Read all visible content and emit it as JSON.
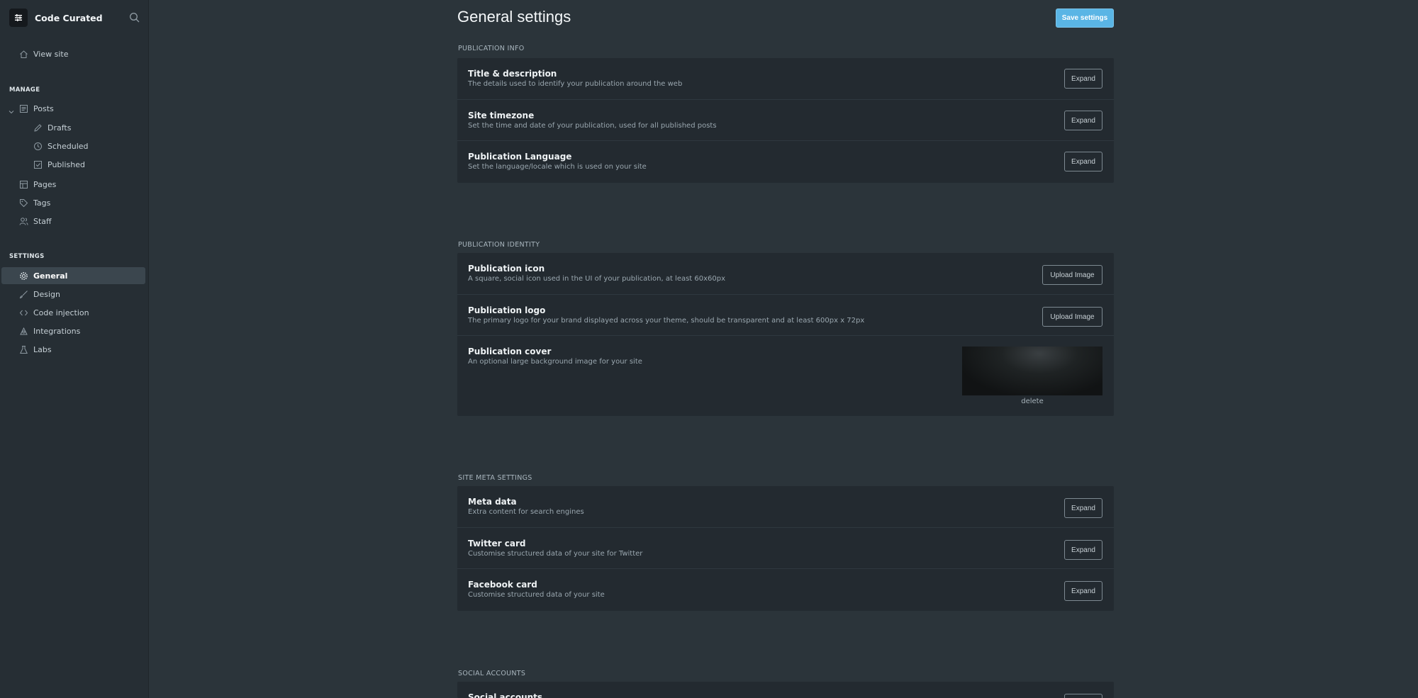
{
  "brand": {
    "name": "Code Curated"
  },
  "sidebar": {
    "view_site": "View site",
    "manage_label": "MANAGE",
    "posts": "Posts",
    "drafts": "Drafts",
    "scheduled": "Scheduled",
    "published": "Published",
    "pages": "Pages",
    "tags": "Tags",
    "staff": "Staff",
    "settings_label": "SETTINGS",
    "general": "General",
    "design": "Design",
    "code_injection": "Code injection",
    "integrations": "Integrations",
    "labs": "Labs"
  },
  "main": {
    "title": "General settings",
    "save_label": "Save settings",
    "sections": {
      "info": {
        "label": "PUBLICATION INFO",
        "rows": [
          {
            "title": "Title & description",
            "desc": "The details used to identify your publication around the web",
            "action": "Expand"
          },
          {
            "title": "Site timezone",
            "desc": "Set the time and date of your publication, used for all published posts",
            "action": "Expand"
          },
          {
            "title": "Publication Language",
            "desc": "Set the language/locale which is used on your site",
            "action": "Expand"
          }
        ]
      },
      "identity": {
        "label": "PUBLICATION IDENTITY",
        "rows": [
          {
            "title": "Publication icon",
            "desc": "A square, social icon used in the UI of your publication, at least 60x60px",
            "action": "Upload Image"
          },
          {
            "title": "Publication logo",
            "desc": "The primary logo for your brand displayed across your theme, should be transparent and at least 600px x 72px",
            "action": "Upload Image"
          },
          {
            "title": "Publication cover",
            "desc": "An optional large background image for your site",
            "action": "delete"
          }
        ]
      },
      "meta": {
        "label": "SITE META SETTINGS",
        "rows": [
          {
            "title": "Meta data",
            "desc": "Extra content for search engines",
            "action": "Expand"
          },
          {
            "title": "Twitter card",
            "desc": "Customise structured data of your site for Twitter",
            "action": "Expand"
          },
          {
            "title": "Facebook card",
            "desc": "Customise structured data of your site",
            "action": "Expand"
          }
        ]
      },
      "social": {
        "label": "SOCIAL ACCOUNTS",
        "rows": [
          {
            "title": "Social accounts"
          }
        ]
      }
    }
  },
  "colors": {
    "background": "#2b343a",
    "sidebar": "#262e34",
    "panel": "#232a30",
    "accent": "#5ab5e5"
  }
}
